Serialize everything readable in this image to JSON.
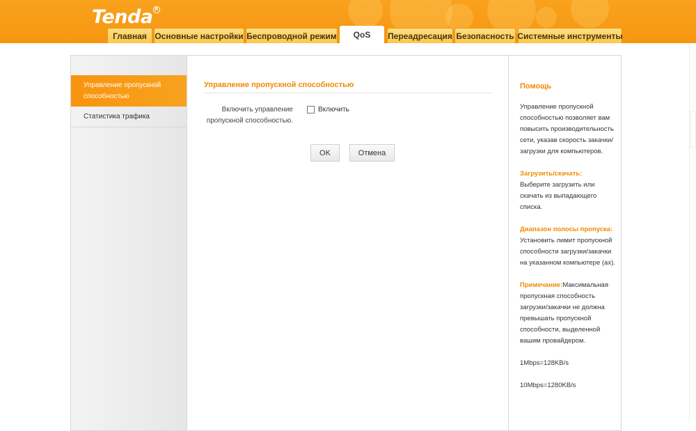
{
  "brand": {
    "logo": "Tenda",
    "reg_mark": "R"
  },
  "nav": {
    "tabs": [
      {
        "label": "Главная"
      },
      {
        "label": "Основные настройки"
      },
      {
        "label": "Беспроводной режим"
      },
      {
        "label": "QoS",
        "active": true
      },
      {
        "label": "Переадресация"
      },
      {
        "label": "Безопасность"
      },
      {
        "label": "Системные инструменты"
      }
    ]
  },
  "sidebar": {
    "items": [
      {
        "label": "Управление пропускной способностью",
        "active": true
      },
      {
        "label": "Статистика трафика"
      }
    ]
  },
  "main": {
    "section_title": "Управление пропускной способностью",
    "enable_label": "Включить управление пропускной способностью.",
    "checkbox_label": "Включить",
    "checkbox_checked": false,
    "ok_label": "OK",
    "cancel_label": "Отмена"
  },
  "help": {
    "title": "Помощь",
    "intro": "Управление пропускной способностью позволяет вам повысить производительность сети, указав скорость закачки/загрузки для компьютеров.",
    "updown_heading": "Загрузить/скачать:",
    "updown_text": "Выберите загрузить или скачать из выпадающего списка.",
    "range_heading": "Диапазон полосы пропуска:",
    "range_text": "Установить лимит пропускной способности загрузки/закачки на указанном компьютере (ах).",
    "note_heading": "Примечание:",
    "note_text": "Максимальная пропускная способность загрузки/закачки не должна превышать пропускной способности, выделенной вашим провайдером.",
    "conversion_1": "1Mbps=128KB/s",
    "conversion_2": "10Mbps=1280KB/s"
  },
  "colors": {
    "header_orange": "#f79510",
    "accent_orange": "#f08a00",
    "tab_yellow": "#fbc84a"
  }
}
